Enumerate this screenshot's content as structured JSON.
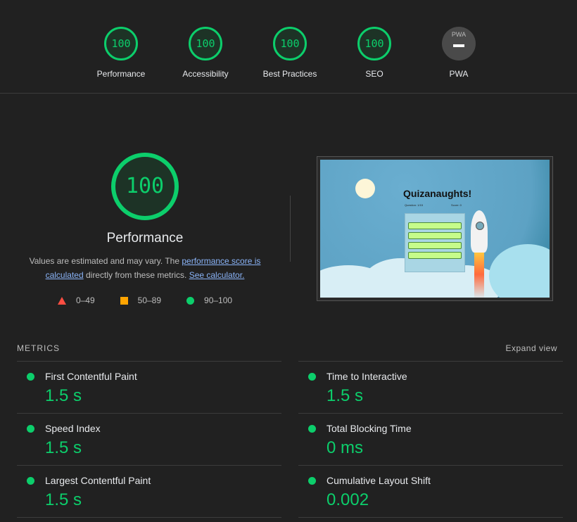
{
  "categories": [
    {
      "label": "Performance",
      "score": "100"
    },
    {
      "label": "Accessibility",
      "score": "100"
    },
    {
      "label": "Best Practices",
      "score": "100"
    },
    {
      "label": "SEO",
      "score": "100"
    },
    {
      "label": "PWA",
      "score": "—",
      "badge": "PWA"
    }
  ],
  "performance": {
    "score": "100",
    "title": "Performance",
    "desc_1": "Values are estimated and may vary. The ",
    "link_1": "performance score is calculated",
    "desc_2": " directly from these metrics. ",
    "link_2": "See calculator.",
    "legend": [
      "0–49",
      "50–89",
      "90–100"
    ]
  },
  "screenshot": {
    "title": "Quizanaughts!",
    "question_count": "Question: 1/15",
    "score": "Score: 0"
  },
  "metrics": {
    "header": "METRICS",
    "expand": "Expand view",
    "items": [
      {
        "name": "First Contentful Paint",
        "value": "1.5 s"
      },
      {
        "name": "Time to Interactive",
        "value": "1.5 s"
      },
      {
        "name": "Speed Index",
        "value": "1.5 s"
      },
      {
        "name": "Total Blocking Time",
        "value": "0 ms"
      },
      {
        "name": "Largest Contentful Paint",
        "value": "1.5 s"
      },
      {
        "name": "Cumulative Layout Shift",
        "value": "0.002"
      }
    ]
  },
  "colors": {
    "pass": "#0cce6b",
    "average": "#ffa400",
    "fail": "#ff4e42"
  }
}
